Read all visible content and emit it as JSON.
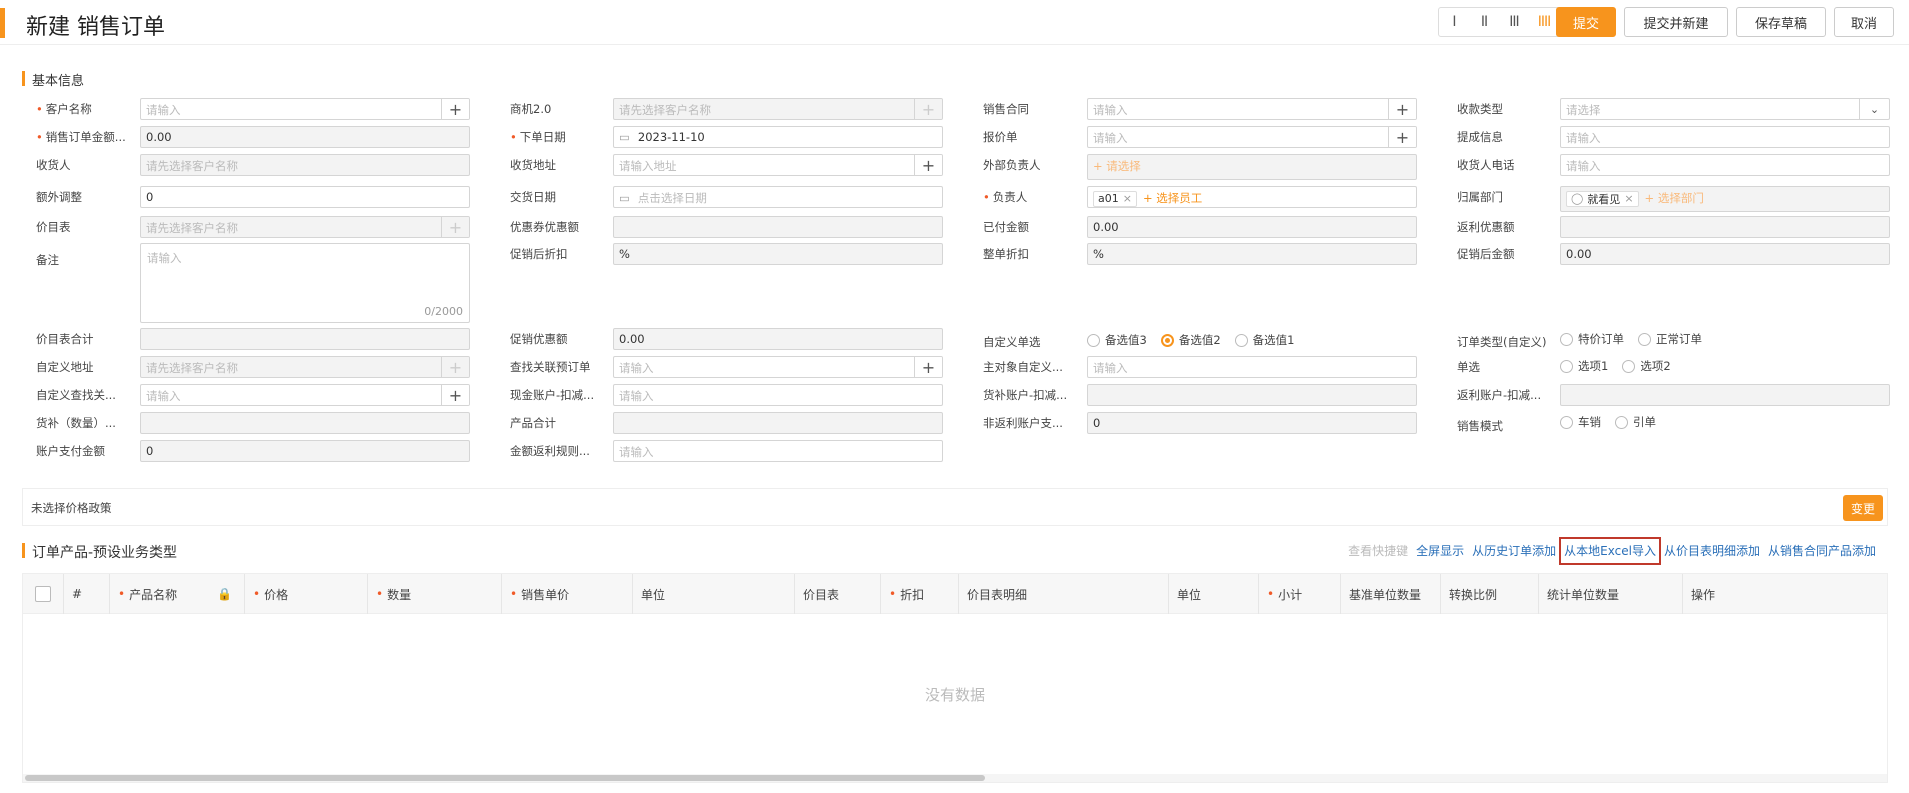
{
  "header": {
    "title": "新建 销售订单",
    "view_buttons": [
      "I",
      "II",
      "III",
      "IIII"
    ],
    "submit": "提交",
    "submit_new": "提交并新建",
    "save_draft": "保存草稿",
    "cancel": "取消"
  },
  "basic_section": "基本信息",
  "fields": {
    "customer_name": {
      "label": "客户名称",
      "placeholder": "请输入"
    },
    "opportunity": {
      "label": "商机2.0",
      "placeholder": "请先选择客户名称"
    },
    "sales_contract": {
      "label": "销售合同",
      "placeholder": "请输入"
    },
    "payment_type": {
      "label": "收款类型",
      "placeholder": "请选择"
    },
    "order_amount": {
      "label": "销售订单金额...",
      "value": "0.00"
    },
    "order_date": {
      "label": "下单日期",
      "value": "2023-11-10"
    },
    "quote": {
      "label": "报价单",
      "placeholder": "请输入"
    },
    "commission_info": {
      "label": "提成信息",
      "placeholder": "请输入"
    },
    "receiver": {
      "label": "收货人",
      "placeholder": "请先选择客户名称"
    },
    "receiver_address": {
      "label": "收货地址",
      "placeholder": "请输入地址"
    },
    "external_owner": {
      "label": "外部负责人",
      "placeholder": "+ 请选择"
    },
    "receiver_phone": {
      "label": "收货人电话",
      "placeholder": "请输入"
    },
    "extra_adjust": {
      "label": "额外调整",
      "value": "0"
    },
    "delivery_date": {
      "label": "交货日期",
      "placeholder": "点击选择日期"
    },
    "owner": {
      "label": "负责人",
      "tag": "a01",
      "add": "+ 选择员工"
    },
    "department": {
      "label": "归属部门",
      "tag": "就看见",
      "add": "+ 选择部门"
    },
    "price_book": {
      "label": "价目表",
      "placeholder": "请先选择客户名称"
    },
    "coupon_discount": {
      "label": "优惠券优惠额",
      "value": ""
    },
    "paid_amount": {
      "label": "已付金额",
      "value": "0.00"
    },
    "rebate_discount": {
      "label": "返利优惠额",
      "value": ""
    },
    "remark": {
      "label": "备注",
      "placeholder": "请输入",
      "counter": "0/2000"
    },
    "promo_discount_rate": {
      "label": "促销后折扣",
      "value": "%"
    },
    "order_discount": {
      "label": "整单折扣",
      "value": "%"
    },
    "promo_amount": {
      "label": "促销后金额",
      "value": "0.00"
    },
    "price_book_total": {
      "label": "价目表合计",
      "value": ""
    },
    "promo_discount_amt": {
      "label": "促销优惠额",
      "value": "0.00"
    },
    "custom_radio": {
      "label": "自定义单选",
      "options": [
        "备选值3",
        "备选值2",
        "备选值1"
      ],
      "selected": "备选值2"
    },
    "order_type": {
      "label": "订单类型(自定义)",
      "options": [
        "特价订单",
        "正常订单"
      ]
    },
    "custom_address": {
      "label": "自定义地址",
      "placeholder": "请先选择客户名称"
    },
    "lookup_pre_order": {
      "label": "查找关联预订单",
      "placeholder": "请输入"
    },
    "main_custom": {
      "label": "主对象自定义...",
      "placeholder": "请输入"
    },
    "single_select": {
      "label": "单选",
      "options": [
        "选项1",
        "选项2"
      ]
    },
    "custom_lookup": {
      "label": "自定义查找关...",
      "placeholder": "请输入"
    },
    "cash_account": {
      "label": "现金账户-扣减...",
      "placeholder": "请输入"
    },
    "goods_account": {
      "label": "货补账户-扣减...",
      "value": ""
    },
    "rebate_account": {
      "label": "返利账户-扣减...",
      "value": ""
    },
    "goods_qty": {
      "label": "货补（数量）...",
      "value": ""
    },
    "product_total": {
      "label": "产品合计",
      "value": ""
    },
    "non_rebate_account": {
      "label": "非返利账户支...",
      "value": "0"
    },
    "sales_mode": {
      "label": "销售模式",
      "options": [
        "车销",
        "引单"
      ]
    },
    "account_paid": {
      "label": "账户支付金额",
      "value": "0"
    },
    "amount_rebate_rule": {
      "label": "金额返利规则...",
      "placeholder": "请输入"
    }
  },
  "policy": {
    "text": "未选择价格政策",
    "change": "变更"
  },
  "product_section": "订单产品-预设业务类型",
  "links": [
    "查看快捷键",
    "全屏显示",
    "从历史订单添加",
    "从本地Excel导入",
    "从价目表明细添加",
    "从销售合同产品添加"
  ],
  "table": {
    "columns": [
      "#",
      "产品名称",
      "价格",
      "数量",
      "销售单价",
      "单位",
      "价目表",
      "折扣",
      "价目表明细",
      "单位",
      "小计",
      "基准单位数量",
      "转换比例",
      "统计单位数量",
      "操作"
    ],
    "empty": "没有数据"
  }
}
